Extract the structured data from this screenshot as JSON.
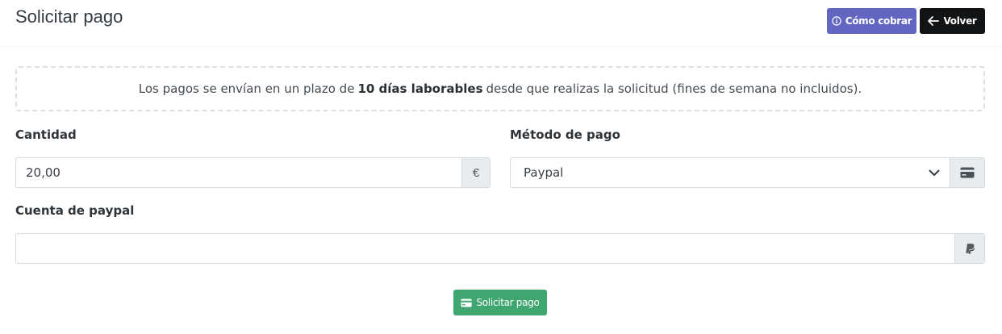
{
  "header": {
    "title": "Solicitar pago",
    "info_button_label": "Cómo cobrar",
    "back_button_label": "Volver"
  },
  "notice": {
    "text_before": "Los pagos se envían en un plazo de",
    "text_bold": "10 días laborables",
    "text_after": "desde que realizas la solicitud (fines de semana no incluidos)."
  },
  "form": {
    "amount": {
      "label": "Cantidad",
      "value": "20,00",
      "addon": "€"
    },
    "method": {
      "label": "Método de pago",
      "selected": "Paypal",
      "addon_icon": "credit-card-icon"
    },
    "paypal_account": {
      "label": "Cuenta de paypal",
      "value": "",
      "addon_icon": "paypal-icon"
    }
  },
  "submit": {
    "label": "Solicitar pago",
    "icon": "credit-card-icon"
  },
  "colors": {
    "info_button": "#6366c1",
    "back_button": "#111315",
    "submit_button": "#3fa66f"
  }
}
